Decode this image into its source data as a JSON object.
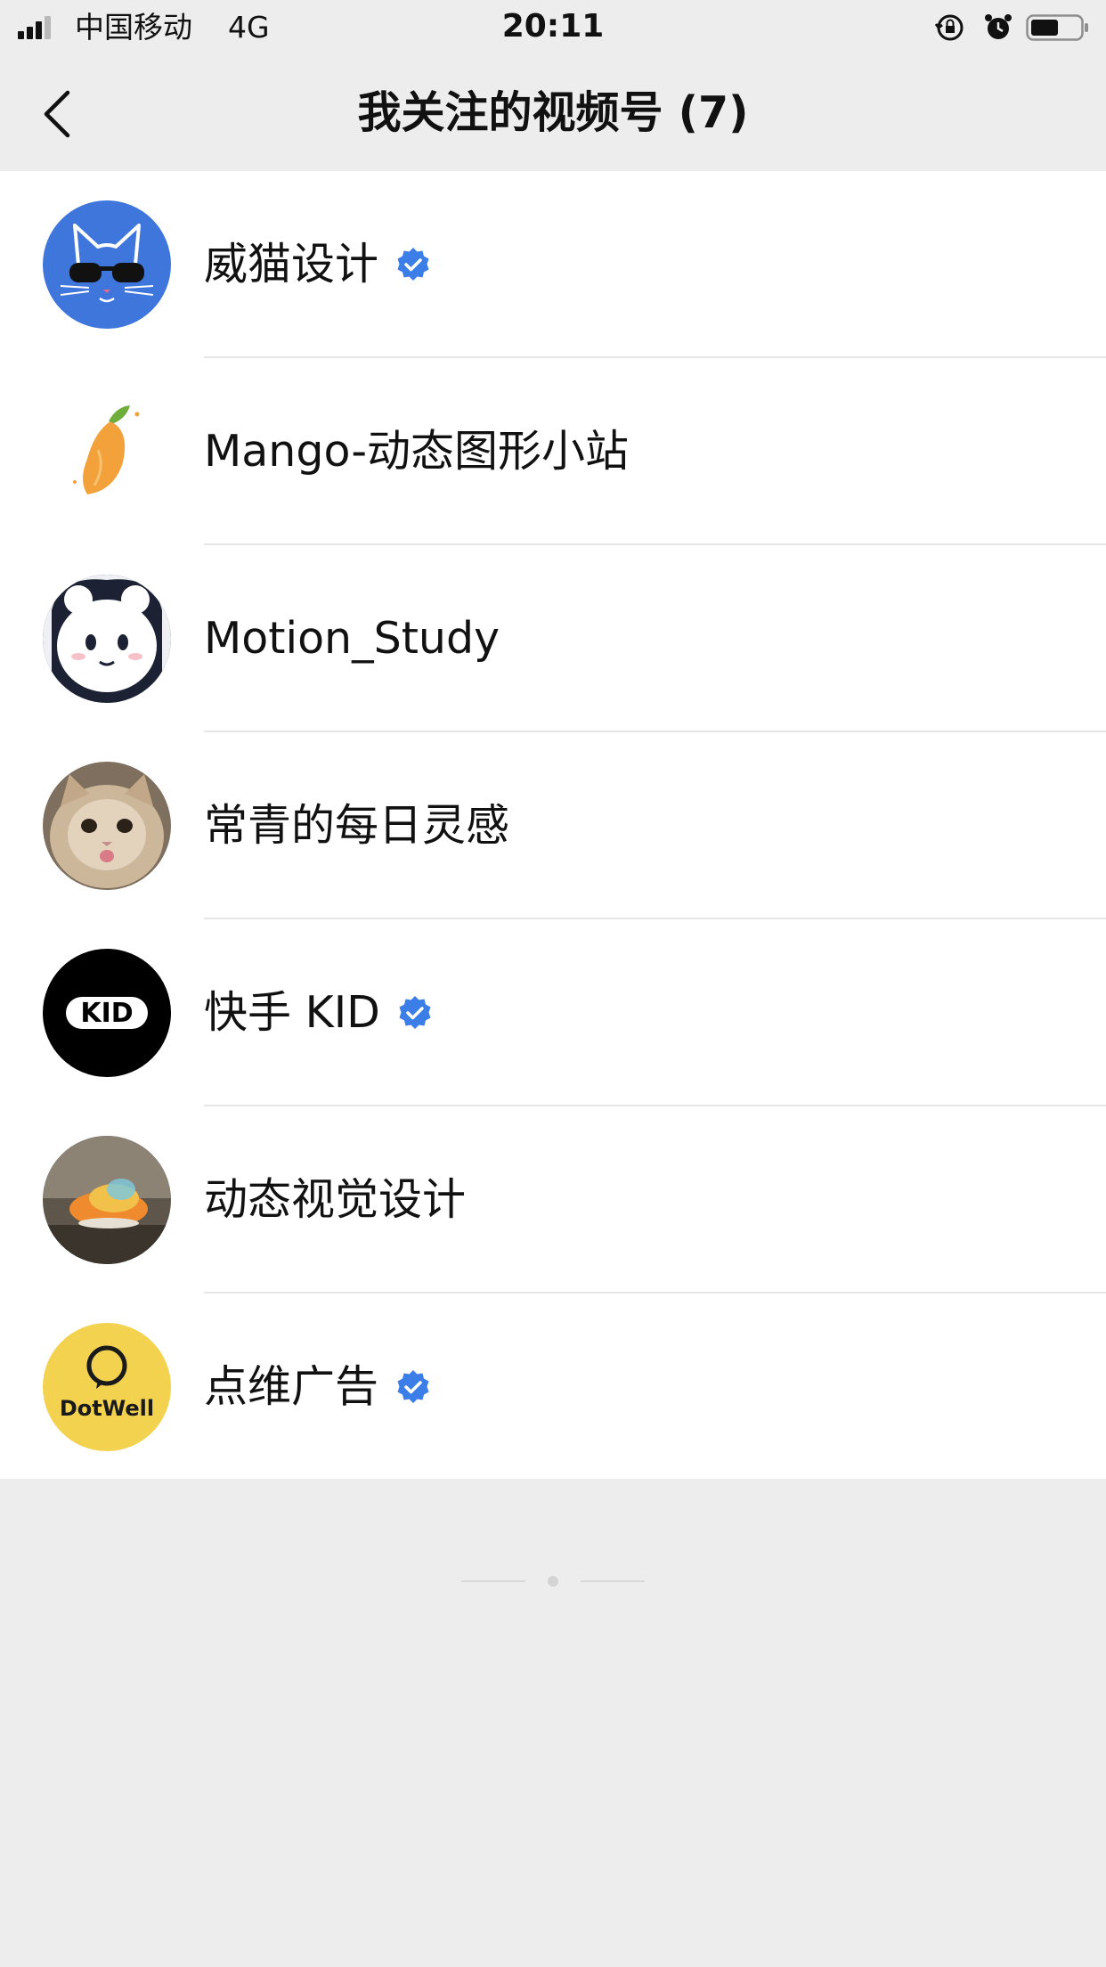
{
  "status_bar": {
    "carrier": "中国移动",
    "network": "4G",
    "time": "20:11",
    "icons": [
      "signal-icon",
      "orientation-lock-icon",
      "alarm-icon",
      "battery-icon"
    ]
  },
  "nav": {
    "title": "我关注的视频号 (7)",
    "back_icon": "chevron-left-icon"
  },
  "channels": [
    {
      "name": "威猫设计",
      "verified": true,
      "avatar": "cat-sunglasses-avatar"
    },
    {
      "name": "Mango-动态图形小站",
      "verified": false,
      "avatar": "mango-avatar"
    },
    {
      "name": "Motion_Study",
      "verified": false,
      "avatar": "cartoon-avatar"
    },
    {
      "name": "常青的每日灵感",
      "verified": false,
      "avatar": "cat-photo-avatar"
    },
    {
      "name": "快手 KID",
      "verified": true,
      "avatar": "kid-logo-avatar",
      "avatar_text": "KID"
    },
    {
      "name": "动态视觉设计",
      "verified": false,
      "avatar": "shell-photo-avatar"
    },
    {
      "name": "点维广告",
      "verified": true,
      "avatar": "dotwell-logo-avatar",
      "avatar_text": "DotWell"
    }
  ],
  "colors": {
    "background": "#ededed",
    "list_background": "#ffffff",
    "verified_badge": "#3b7ee8",
    "text": "#111111"
  }
}
